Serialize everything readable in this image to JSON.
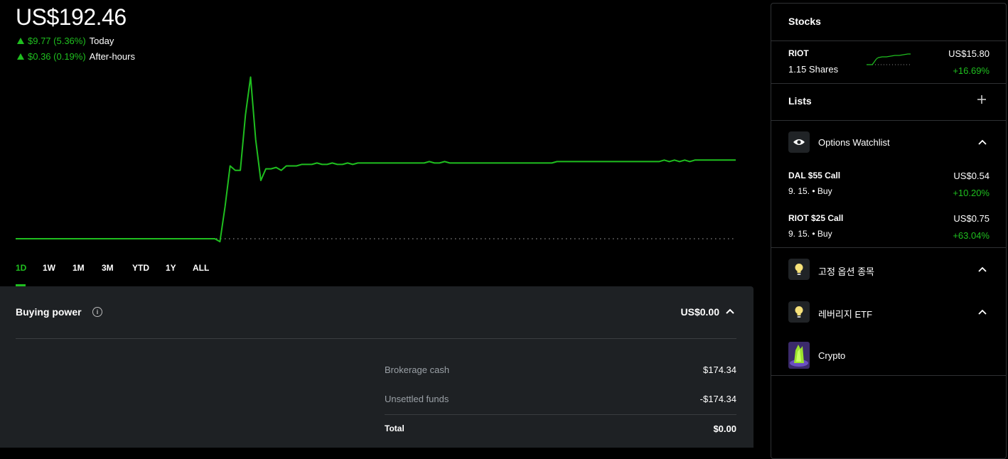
{
  "portfolio": {
    "value": "US$192.46",
    "today_change": "$9.77 (5.36%)",
    "today_label": "Today",
    "after_hours_change": "$0.36 (0.19%)",
    "after_hours_label": "After-hours"
  },
  "chart_data": {
    "type": "line",
    "series": [
      {
        "values": [
          100,
          100,
          100,
          100,
          100,
          100,
          100,
          100,
          100,
          100,
          100,
          100,
          100,
          100,
          100,
          100,
          100,
          100,
          100,
          100,
          100,
          100,
          100,
          100,
          100,
          100,
          100,
          100,
          100,
          100,
          100,
          100,
          100,
          100,
          100,
          100,
          100,
          100,
          100,
          100,
          98,
          122,
          150,
          147,
          147,
          185,
          211,
          168,
          140,
          148,
          148,
          149,
          147,
          150,
          150,
          150,
          151,
          151,
          151,
          152,
          151,
          151,
          152,
          151,
          151,
          152,
          151,
          152,
          152,
          152,
          152,
          152,
          152,
          152,
          152,
          152,
          152,
          152,
          152,
          152,
          152,
          153,
          152,
          152,
          153,
          152,
          152,
          152,
          152,
          152,
          152,
          152,
          152,
          152,
          152,
          152,
          152,
          152,
          152,
          152,
          152,
          152,
          152,
          152,
          152,
          152,
          153,
          153,
          153,
          153,
          153,
          153,
          153,
          153,
          153,
          153,
          153,
          153,
          153,
          153,
          153,
          153,
          153,
          153,
          153,
          153,
          153,
          154,
          153,
          154,
          153,
          154,
          153,
          154,
          154,
          154,
          154,
          154,
          154,
          154,
          154,
          154
        ]
      }
    ],
    "baseline": 100,
    "color": "#1fbf1f"
  },
  "ranges": [
    "1D",
    "1W",
    "1M",
    "3M",
    "YTD",
    "1Y",
    "ALL"
  ],
  "active_range": "1D",
  "buying_power": {
    "title": "Buying power",
    "value": "US$0.00",
    "rows": [
      {
        "label": "Brokerage cash",
        "value": "$174.34"
      },
      {
        "label": "Unsettled funds",
        "value": "-$174.34"
      },
      {
        "label": "Total",
        "value": "$0.00"
      }
    ]
  },
  "sidebar": {
    "stocks_title": "Stocks",
    "stock": {
      "ticker": "RIOT",
      "shares": "1.15 Shares",
      "price": "US$15.80",
      "change": "+16.69%"
    },
    "lists_title": "Lists",
    "lists": [
      {
        "name": "Options Watchlist",
        "icon": "eye-icon"
      },
      {
        "name": "고정 옵션 종목",
        "icon": "lightbulb-icon"
      },
      {
        "name": "레버리지 ETF",
        "icon": "lightbulb-icon"
      },
      {
        "name": "Crypto",
        "icon": "crypto-icon"
      }
    ],
    "options": [
      {
        "name": "DAL $55 Call",
        "sub": "9. 15. • Buy",
        "price": "US$0.54",
        "change": "+10.20%"
      },
      {
        "name": "RIOT $25 Call",
        "sub": "9. 15. • Buy",
        "price": "US$0.75",
        "change": "+63.04%"
      }
    ]
  }
}
